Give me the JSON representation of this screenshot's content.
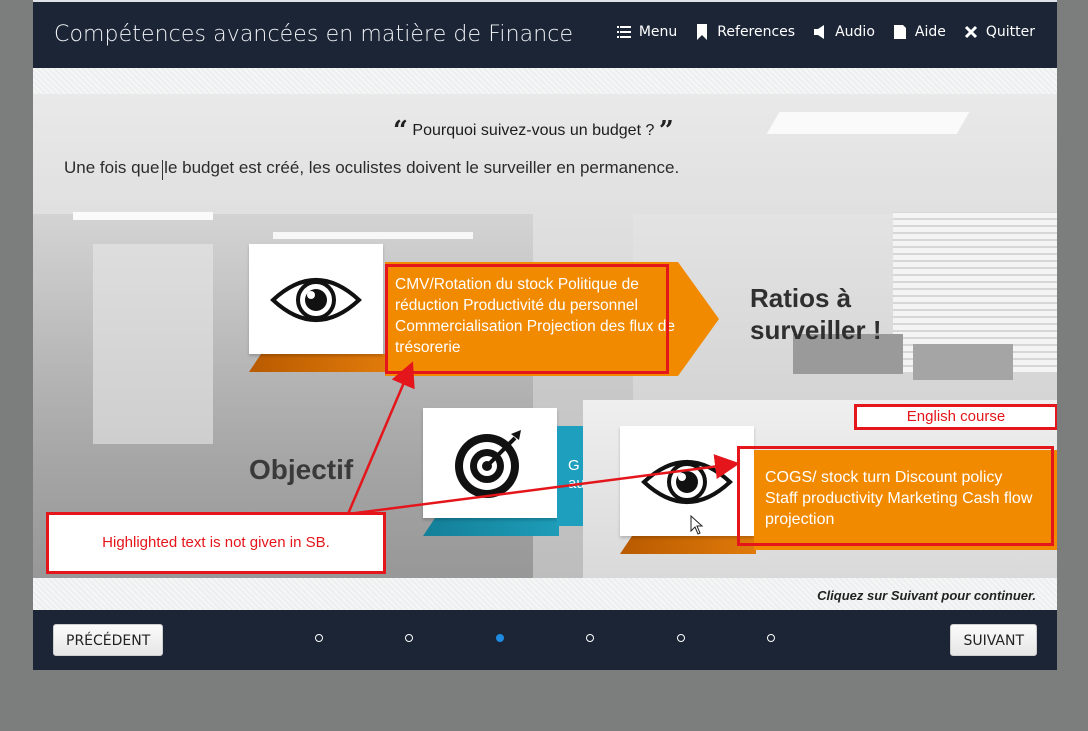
{
  "header": {
    "title": "Compétences avancées en matière de Finance",
    "nav": [
      {
        "label": "Menu",
        "icon": "menu-icon"
      },
      {
        "label": "References",
        "icon": "bookmark-icon"
      },
      {
        "label": "Audio",
        "icon": "speaker-icon"
      },
      {
        "label": "Aide",
        "icon": "help-doc-icon"
      },
      {
        "label": "Quitter",
        "icon": "close-icon"
      }
    ]
  },
  "slide": {
    "question": "Pourquoi suivez-vous un budget ?",
    "lead": "Une fois que le budget est créé, les oculistes doivent le surveiller en permanence.",
    "card1_text": "CMV/Rotation du stock Politique de réduction Productivité du personnel Commercialisation Projection des flux de trésorerie",
    "ratios_heading_line1": "Ratios à",
    "ratios_heading_line2": "surveiller !",
    "objectif_heading": "Objectif",
    "teal_text_line1": "G",
    "teal_text_line2": "au"
  },
  "overlay": {
    "english_label": "English course",
    "english_text": "COGS/ stock turn Discount policy Staff productivity Marketing Cash flow projection",
    "note": "Highlighted text is not given in SB."
  },
  "footer": {
    "continue_hint": "Cliquez sur Suivant pour continuer.",
    "prev_label": "PRÉCÉDENT",
    "next_label": "SUIVANT",
    "page_count": 6,
    "active_page": 3
  },
  "colors": {
    "navy": "#1b2536",
    "orange": "#f28a00",
    "teal": "#1e9fbd",
    "annotation_red": "#e4161b",
    "active_dot": "#1f8be0"
  }
}
